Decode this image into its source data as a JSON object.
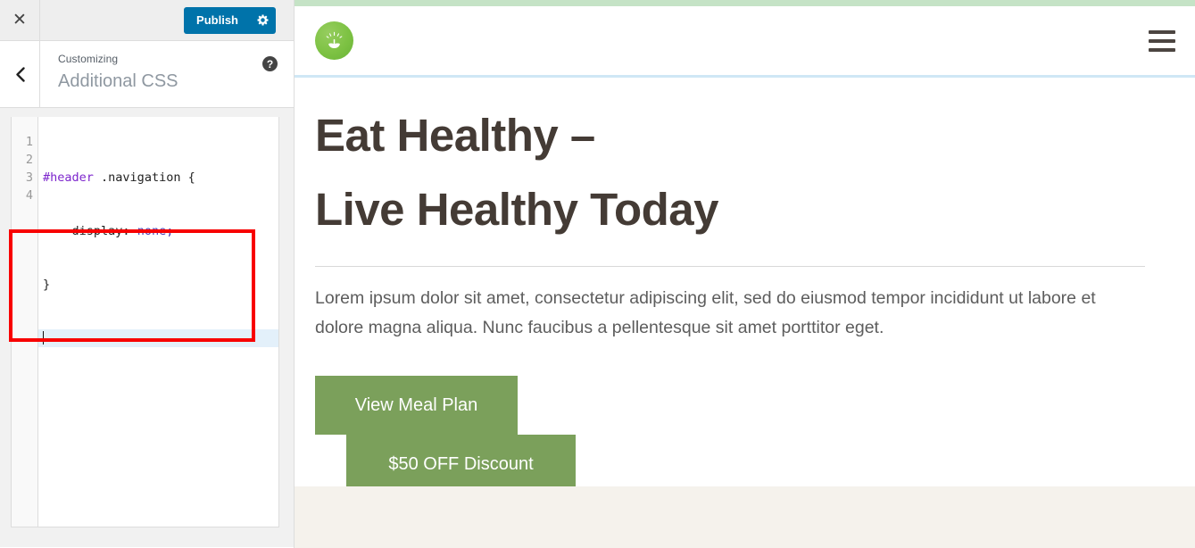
{
  "customizer": {
    "close_icon": "close-icon",
    "publish_label": "Publish",
    "gear_icon": "gear-icon",
    "back_icon": "chevron-left-icon",
    "eyebrow": "Customizing",
    "title": "Additional CSS",
    "help_icon": "help-icon",
    "help_label": "?",
    "close_label": "✕",
    "back_label": "‹",
    "editor": {
      "line_numbers": [
        "1",
        "2",
        "3",
        "4"
      ],
      "active_line": 4,
      "code_lines": [
        {
          "selector": "#header",
          "space": " ",
          "class": ".navigation",
          "brace": " {"
        },
        {
          "indent": "    ",
          "property": "display:",
          "space": " ",
          "value": "none;"
        },
        {
          "brace": "}"
        },
        {
          "empty": ""
        }
      ],
      "raw_code": "#header .navigation {\n    display: none;\n}\n"
    }
  },
  "preview": {
    "logo_icon": "sprout-logo-icon",
    "menu_icon": "hamburger-menu-icon",
    "hero_title": "Eat Healthy –\nLive Healthy Today",
    "hero_paragraph": "Lorem ipsum dolor sit amet, consectetur adipiscing elit, sed do eiusmod tempor incididunt ut labore et dolore magna aliqua. Nunc faucibus a pellentesque sit amet porttitor eget.",
    "cta_primary": "View Meal Plan",
    "cta_secondary": "$50 OFF Discount"
  },
  "colors": {
    "publish_blue": "#0073aa",
    "cta_green": "#7ba05b",
    "logo_green": "#7dc243",
    "top_band_green": "#c5e3c6",
    "header_border_blue": "#cfe7f5",
    "heading_brown": "#443b35",
    "annotation_red": "#f80000",
    "bottom_band_cream": "#f5f2ec",
    "active_line_blue": "#e3f0fa"
  }
}
